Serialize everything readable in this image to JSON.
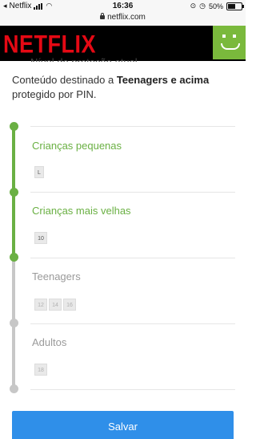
{
  "status_bar": {
    "back_app": "Netflix",
    "time": "16:36",
    "battery": "50%"
  },
  "browser": {
    "url": "netflix.com"
  },
  "header": {
    "logo_text": "NETFLIX",
    "avatar_color": "#7ab93c"
  },
  "page": {
    "title": "Nível de proteção atual",
    "description_prefix": "Conteúdo destinado a ",
    "description_bold": "Teenagers e acima",
    "description_suffix": " protegido por PIN."
  },
  "maturity_levels": [
    {
      "label": "Crianças pequenas",
      "ratings": [
        "L"
      ],
      "state": "unprotected"
    },
    {
      "label": "Crianças mais velhas",
      "ratings": [
        "10"
      ],
      "state": "unprotected"
    },
    {
      "label": "Teenagers",
      "ratings": [
        "12",
        "14",
        "16"
      ],
      "state": "protected"
    },
    {
      "label": "Adultos",
      "ratings": [
        "18"
      ],
      "state": "protected"
    }
  ],
  "actions": {
    "save_label": "Salvar"
  },
  "colors": {
    "active_green": "#6ab043",
    "inactive_gray": "#c7c7c7",
    "button_blue": "#2f8fe9",
    "netflix_red": "#e50914"
  }
}
